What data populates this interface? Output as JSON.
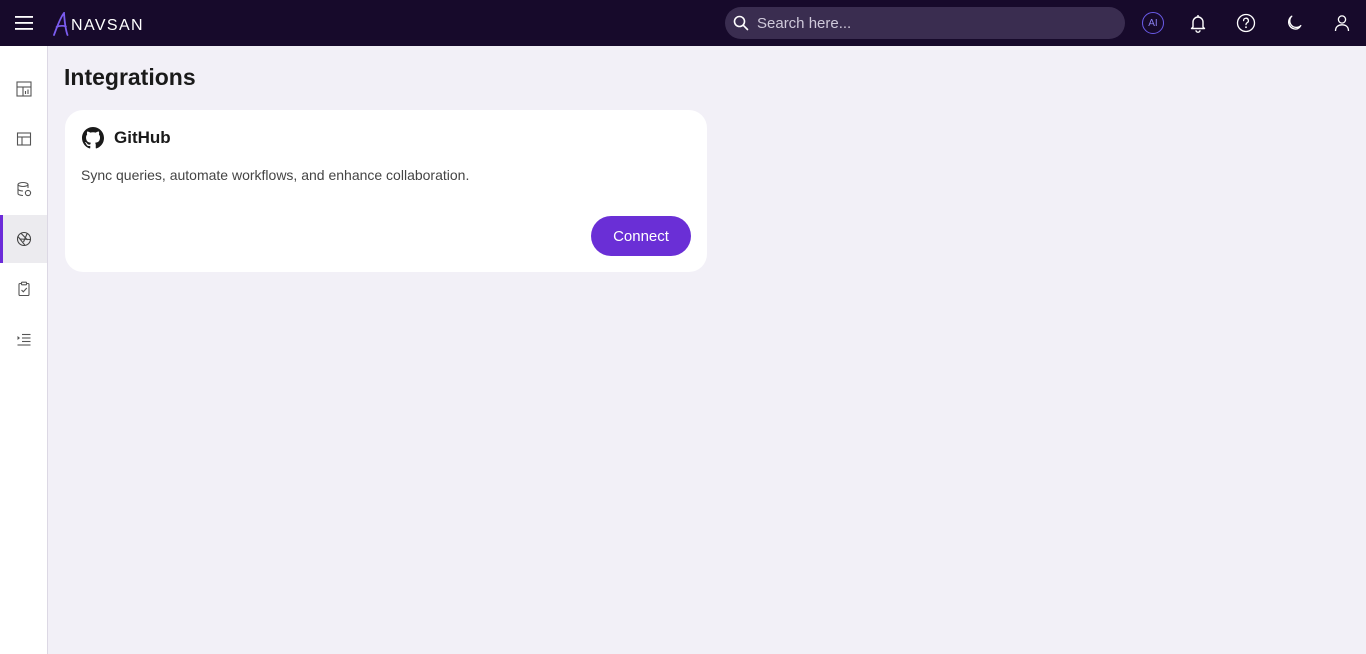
{
  "header": {
    "logo_text": "NAVSAN",
    "search_placeholder": "Search here...",
    "ai_label": "AI"
  },
  "sidebar": {
    "items": [
      {
        "name": "dashboard",
        "icon": "dashboard-icon"
      },
      {
        "name": "layout",
        "icon": "layout-icon"
      },
      {
        "name": "database",
        "icon": "database-icon"
      },
      {
        "name": "integrations",
        "icon": "aperture-icon",
        "active": true
      },
      {
        "name": "tasks",
        "icon": "clipboard-check-icon"
      },
      {
        "name": "logs",
        "icon": "list-indent-icon"
      }
    ]
  },
  "main": {
    "title": "Integrations",
    "integrations": [
      {
        "name": "GitHub",
        "icon": "github-icon",
        "description": "Sync queries, automate workflows, and enhance collaboration.",
        "action_label": "Connect"
      }
    ]
  },
  "colors": {
    "topbar": "#170a2b",
    "accent": "#6a2fd6",
    "background": "#f2f0f7"
  }
}
